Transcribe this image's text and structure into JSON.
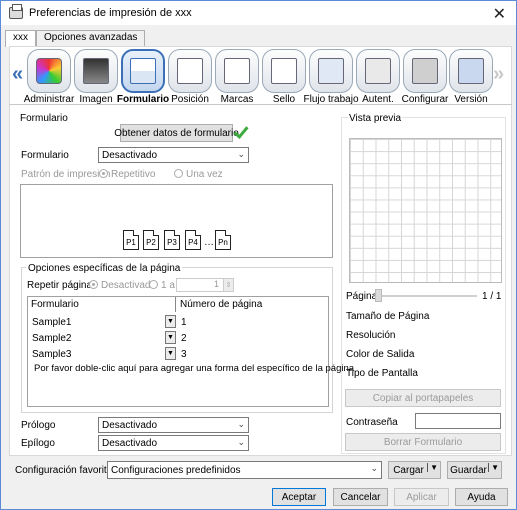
{
  "window": {
    "title": "Preferencias de impresión de xxx",
    "close_label": "✕"
  },
  "tabs": [
    "xxx",
    "Opciones avanzadas"
  ],
  "toolbar": {
    "items": [
      {
        "label": "Administrar",
        "icon": "administrar-icon"
      },
      {
        "label": "Imagen",
        "icon": "imagen-icon"
      },
      {
        "label": "Formulario",
        "icon": "formulario-icon",
        "selected": true
      },
      {
        "label": "Posición",
        "icon": "posicion-icon"
      },
      {
        "label": "Marcas",
        "icon": "marcas-icon"
      },
      {
        "label": "Sello",
        "icon": "sello-icon"
      },
      {
        "label": "Flujo trabajo",
        "icon": "flujo-trabajo-icon"
      },
      {
        "label": "Autent.",
        "icon": "autent-icon"
      },
      {
        "label": "Configurar",
        "icon": "configurar-icon"
      },
      {
        "label": "Versión",
        "icon": "version-icon"
      }
    ],
    "left_arrow": "«",
    "right_arrow": "»"
  },
  "form": {
    "section_title": "Formulario",
    "get_data_button": "Obtener datos de formulario",
    "formulario_label": "Formulario",
    "formulario_value": "Desactivado",
    "patron_label": "Patrón de impresión",
    "patron_opt1": "Repetitivo",
    "patron_opt2": "Una vez",
    "pages": [
      "P1",
      "P2",
      "P3",
      "P4",
      "…",
      "Pn"
    ],
    "specific_title": "Opciones específicas de la página",
    "repeat_label": "Repetir páginas",
    "repeat_opt1": "Desactivado",
    "repeat_opt2": "1 a",
    "repeat_value": "1",
    "table_headers": [
      "Formulario",
      "Número de página"
    ],
    "rows": [
      {
        "name": "Sample1",
        "page": "1"
      },
      {
        "name": "Sample2",
        "page": "2"
      },
      {
        "name": "Sample3",
        "page": "3"
      }
    ],
    "hint": "Por favor doble-clic aquí para agregar una forma del específico de la página",
    "prologo_label": "Prólogo",
    "prologo_value": "Desactivado",
    "epilogo_label": "Epílogo",
    "epilogo_value": "Desactivado"
  },
  "preview": {
    "title": "Vista previa",
    "page_label": "Página",
    "page_count": "1 / 1",
    "fields": [
      "Tamaño de Página",
      "Resolución",
      "Color de Salida",
      "Tipo de Pantalla"
    ],
    "copy_button": "Copiar al portapapeles",
    "password_label": "Contraseña",
    "delete_button": "Borrar Formulario"
  },
  "favorites": {
    "label": "Configuración favorita",
    "value": "Configuraciones predefinidos",
    "load": "Cargar",
    "save": "Guardar"
  },
  "footer": {
    "ok": "Aceptar",
    "cancel": "Cancelar",
    "apply": "Aplicar",
    "help": "Ayuda"
  },
  "colors": {
    "accent": "#3b6fb6",
    "check": "#3caa3c"
  }
}
